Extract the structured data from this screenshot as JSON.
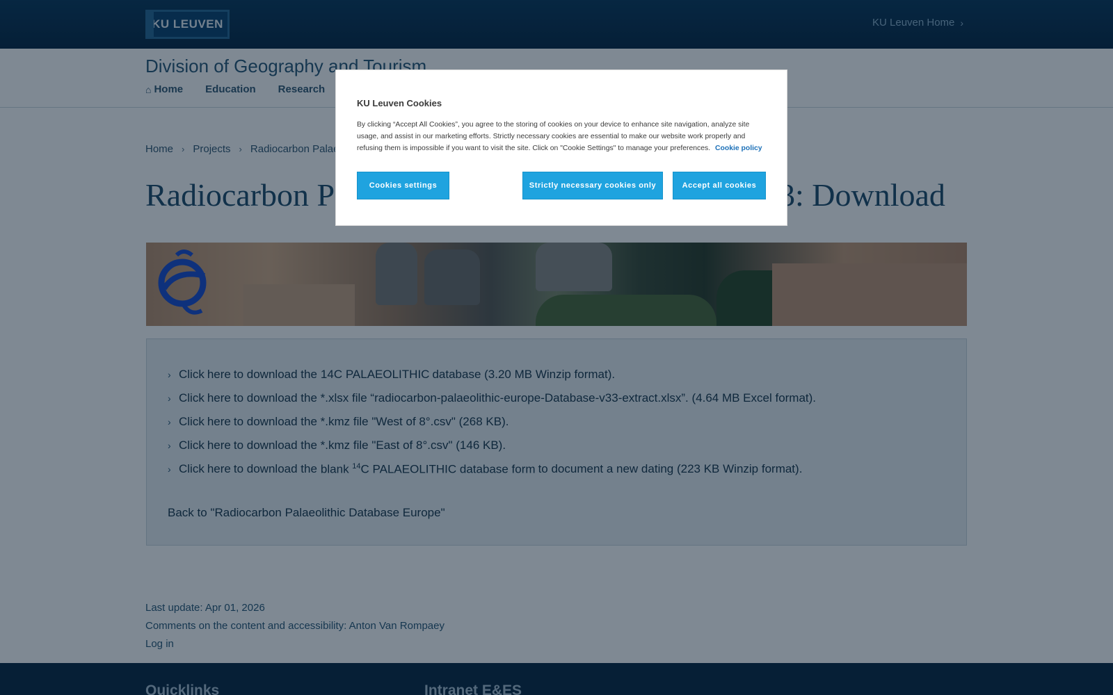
{
  "header": {
    "logo_text": "KU LEUVEN",
    "home_link": "KU Leuven Home"
  },
  "site": {
    "title": "Division of Geography and Tourism",
    "nav": [
      {
        "label": "Home",
        "icon": "home-icon"
      },
      {
        "label": "Education"
      },
      {
        "label": "Research"
      }
    ]
  },
  "breadcrumb": {
    "items": [
      "Home",
      "Projects",
      "Radiocarbon Palae"
    ]
  },
  "page": {
    "title_left": "Radiocarbon P",
    "title_right": "3: Download"
  },
  "downloads": {
    "items": [
      {
        "prefix": "Click",
        "link": "here",
        "mid": "to download the",
        "target": "14C PALAEOLITHIC",
        "suffix": "database (3.20 MB Winzip format)."
      },
      {
        "prefix": "Click",
        "link": "here",
        "mid": "to download the *.xlsx file “",
        "target": "radiocarbon-palaeolithic-europe-Database-v33-extract.xlsx",
        "suffix": "”. (4.64 MB Excel format)."
      },
      {
        "prefix": "Click",
        "link": "here",
        "mid": "to download the *.kmz file \"",
        "target": "West of 8°.csv",
        "suffix": "\" (268 KB)."
      },
      {
        "prefix": "Click",
        "link": "here",
        "mid": "to download the *.kmz file \"",
        "target": "East of 8°.csv",
        "suffix": "\" (146 KB)."
      },
      {
        "prefix": "Click",
        "link": "here",
        "mid": "to download the",
        "target_pre": "blank ",
        "target_sup": "14",
        "target": "C PALAEOLITHIC database form",
        "suffix": "to document a new dating (223 KB Winzip format)."
      }
    ],
    "back_link": "Back to",
    "back_text": "\"Radiocarbon Palaeolithic Database Europe\""
  },
  "meta": {
    "last_update": "Last update: Apr 01, 2026",
    "comments_label": "Comments on the content and accessibility:",
    "comments_person": "Anton Van Rompaey",
    "login": "Log in"
  },
  "footer": {
    "col1": "Quicklinks",
    "col2": "Intranet E&ES"
  },
  "cookie": {
    "title": "KU Leuven Cookies",
    "text": "By clicking “Accept All Cookies”, you agree to the storing of cookies on your device to enhance site navigation, analyze site usage, and assist in our marketing efforts. Strictly necessary cookies are essential to make our website work properly and refusing them is impossible if you want to visit the site. Click on \"Cookie Settings\" to manage your preferences.",
    "policy_link": "Cookie policy",
    "btn_settings": "Cookies settings",
    "btn_necessary": "Strictly necessary cookies only",
    "btn_accept": "Accept all cookies",
    "accent": "#1fa3df"
  }
}
